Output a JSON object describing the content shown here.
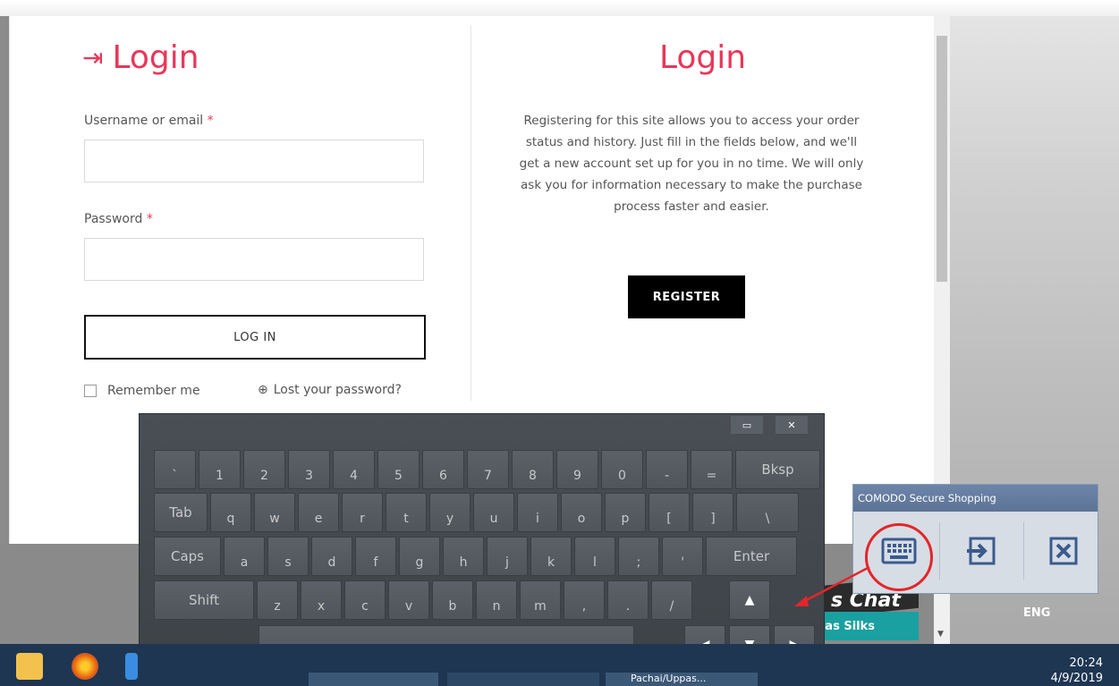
{
  "left": {
    "title": "Login",
    "username_label": "Username or email",
    "password_label": "Password",
    "required_mark": "*",
    "login_button": "LOG IN",
    "remember": "Remember me",
    "lost_password": "Lost your password?"
  },
  "right": {
    "title": "Login",
    "description": "Registering for this site allows you to access your order status and history. Just fill in the fields below, and we'll get a new account set up for you in no time. We will only ask you for information necessary to make the purchase process faster and easier.",
    "register_button": "REGISTER"
  },
  "keyboard": {
    "window_controls": [
      "▭",
      "✕"
    ],
    "row1": [
      "`",
      "1",
      "2",
      "3",
      "4",
      "5",
      "6",
      "7",
      "8",
      "9",
      "0",
      "-",
      "=",
      "Bksp"
    ],
    "row2": [
      "Tab",
      "q",
      "w",
      "e",
      "r",
      "t",
      "y",
      "u",
      "i",
      "o",
      "p",
      "[",
      "]",
      "\\"
    ],
    "row3": [
      "Caps",
      "a",
      "s",
      "d",
      "f",
      "g",
      "h",
      "j",
      "k",
      "l",
      ";",
      "'",
      "Enter"
    ],
    "row4": [
      "Shift",
      "z",
      "x",
      "c",
      "v",
      "b",
      "n",
      "m",
      ",",
      ".",
      "/"
    ],
    "arrows": {
      "up": "▲",
      "left": "◀",
      "down": "▼",
      "right": "▶"
    }
  },
  "comodo": {
    "title": "COMODO Secure Shopping",
    "buttons": [
      "keyboard-icon",
      "exit-icon",
      "close-icon"
    ],
    "language": "ENG"
  },
  "ad": {
    "line1": "s Chat",
    "line2": "pas Silks"
  },
  "taskbar": {
    "time": "20:24",
    "date": "4/9/2019",
    "item_text": "Pachai/Uppas..."
  },
  "colors": {
    "accent": "#e8375a",
    "taskbar": "#1e3652",
    "keyboard": "#454a50"
  }
}
